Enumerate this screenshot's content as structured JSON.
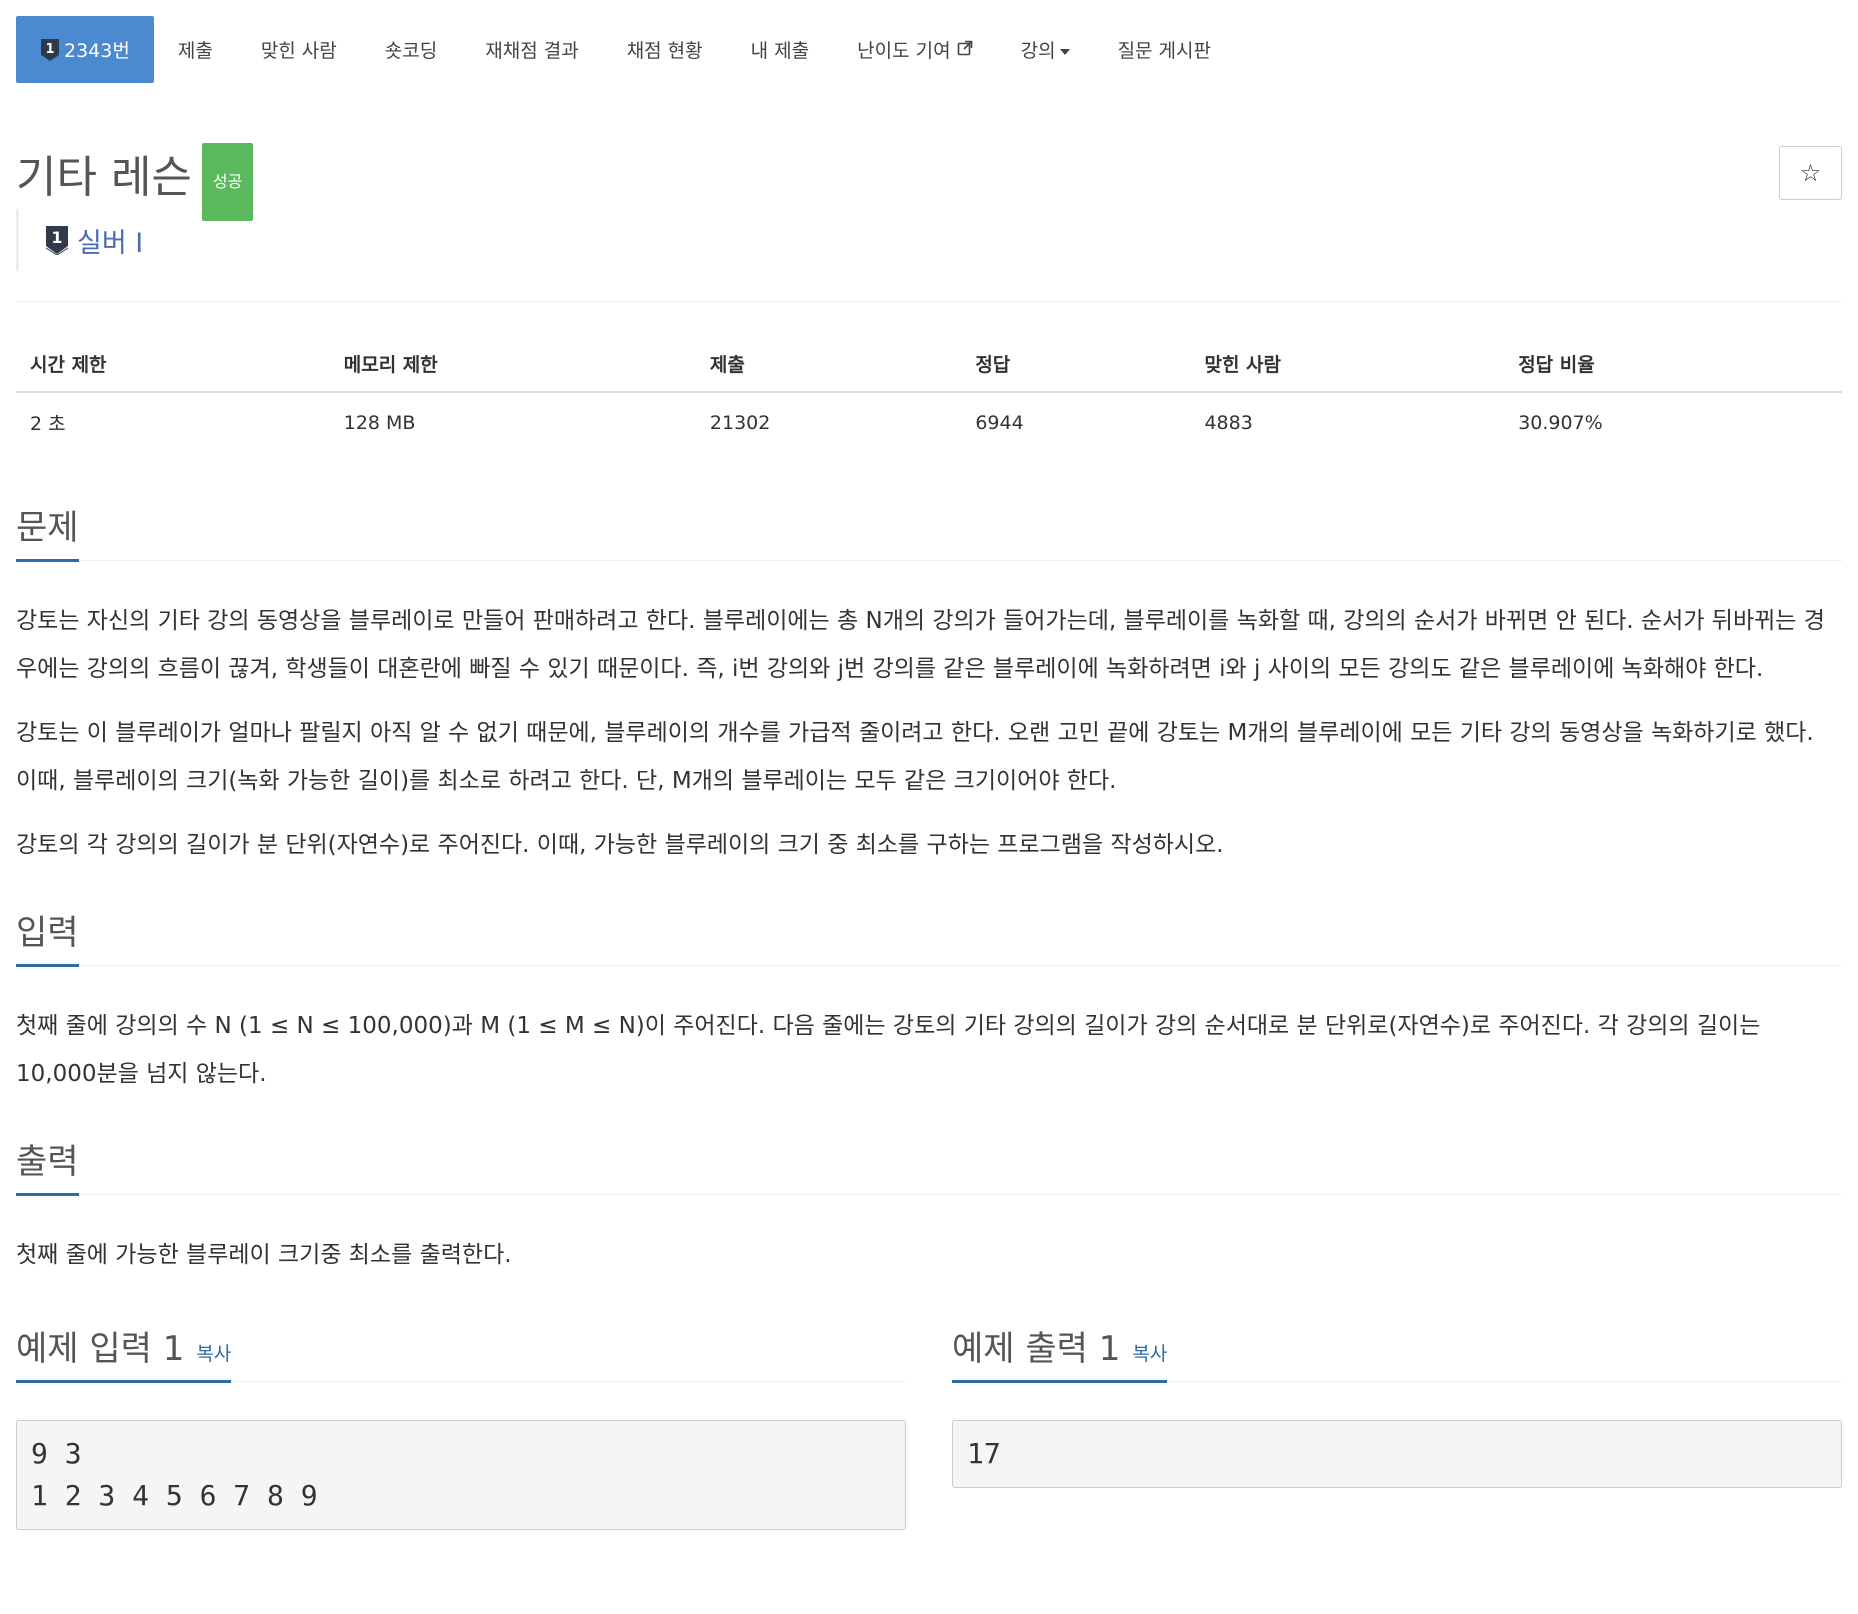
{
  "nav": {
    "tabs": [
      {
        "label": "2343번",
        "active": true,
        "tier_number": "1"
      },
      {
        "label": "제출"
      },
      {
        "label": "맞힌 사람"
      },
      {
        "label": "숏코딩"
      },
      {
        "label": "재채점 결과"
      },
      {
        "label": "채점 현황"
      },
      {
        "label": "내 제출"
      },
      {
        "label": "난이도 기여"
      },
      {
        "label": "강의"
      },
      {
        "label": "질문 게시판"
      }
    ]
  },
  "problem": {
    "title": "기타 레슨",
    "status_badge": "성공",
    "tier_label": "실버 I",
    "tier_number": "1",
    "star": "☆"
  },
  "info": {
    "headers": [
      "시간 제한",
      "메모리 제한",
      "제출",
      "정답",
      "맞힌 사람",
      "정답 비율"
    ],
    "values": [
      "2 초",
      "128 MB",
      "21302",
      "6944",
      "4883",
      "30.907%"
    ]
  },
  "sections": {
    "problem": {
      "heading": "문제",
      "paragraphs": [
        "강토는 자신의 기타 강의 동영상을 블루레이로 만들어 판매하려고 한다. 블루레이에는 총 N개의 강의가 들어가는데, 블루레이를 녹화할 때, 강의의 순서가 바뀌면 안 된다. 순서가 뒤바뀌는 경우에는 강의의 흐름이 끊겨, 학생들이 대혼란에 빠질 수 있기 때문이다. 즉, i번 강의와 j번 강의를 같은 블루레이에 녹화하려면 i와 j 사이의 모든 강의도 같은 블루레이에 녹화해야 한다.",
        "강토는 이 블루레이가 얼마나 팔릴지 아직 알 수 없기 때문에, 블루레이의 개수를 가급적 줄이려고 한다. 오랜 고민 끝에 강토는 M개의 블루레이에 모든 기타 강의 동영상을 녹화하기로 했다. 이때, 블루레이의 크기(녹화 가능한 길이)를 최소로 하려고 한다. 단, M개의 블루레이는 모두 같은 크기이어야 한다.",
        "강토의 각 강의의 길이가 분 단위(자연수)로 주어진다. 이때, 가능한 블루레이의 크기 중 최소를 구하는 프로그램을 작성하시오."
      ]
    },
    "input": {
      "heading": "입력",
      "paragraphs": [
        "첫째 줄에 강의의 수 N (1 ≤ N ≤ 100,000)과 M (1 ≤ M ≤ N)이 주어진다. 다음 줄에는 강토의 기타 강의의 길이가 강의 순서대로 분 단위로(자연수)로 주어진다. 각 강의의 길이는 10,000분을 넘지 않는다."
      ]
    },
    "output": {
      "heading": "출력",
      "paragraphs": [
        "첫째 줄에 가능한 블루레이 크기중 최소를 출력한다."
      ]
    }
  },
  "samples": {
    "input": {
      "heading": "예제 입력 1",
      "copy": "복사",
      "content": "9 3\n1 2 3 4 5 6 7 8 9"
    },
    "output": {
      "heading": "예제 출력 1",
      "copy": "복사",
      "content": "17"
    }
  },
  "colors": {
    "accent": "#4b8ad1",
    "success": "#5cb85c",
    "link": "#2e6da4",
    "tier": "#4b6cb2"
  }
}
